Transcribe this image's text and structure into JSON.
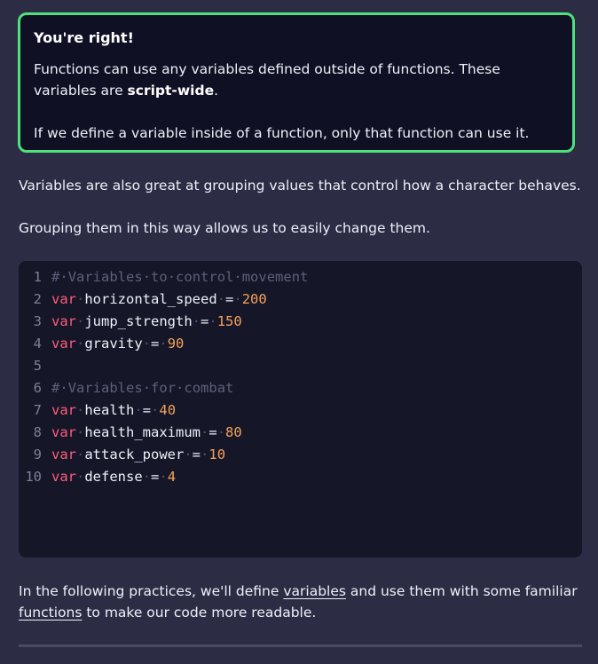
{
  "callout": {
    "title": "You're right!",
    "line1_before": "Functions can use any variables defined outside of functions. These variables are ",
    "line1_bold": "script-wide",
    "line1_after": ".",
    "line2": "If we define a variable inside of a function, only that function can use it."
  },
  "paragraphs": {
    "p1": "Variables are also great at grouping values that control how a character behaves.",
    "p2": "Grouping them in this way allows us to easily change them."
  },
  "code": {
    "lines": [
      {
        "num": "1",
        "comment": "# Variables to control movement"
      },
      {
        "num": "2",
        "kw": "var",
        "name": "horizontal_speed",
        "op": "=",
        "value": "200"
      },
      {
        "num": "3",
        "kw": "var",
        "name": "jump_strength",
        "op": "=",
        "value": "150"
      },
      {
        "num": "4",
        "kw": "var",
        "name": "gravity",
        "op": "=",
        "value": "90"
      },
      {
        "num": "5"
      },
      {
        "num": "6",
        "comment": "# Variables for combat"
      },
      {
        "num": "7",
        "kw": "var",
        "name": "health",
        "op": "=",
        "value": "40"
      },
      {
        "num": "8",
        "kw": "var",
        "name": "health_maximum",
        "op": "=",
        "value": "80"
      },
      {
        "num": "9",
        "kw": "var",
        "name": "attack_power",
        "op": "=",
        "value": "10"
      },
      {
        "num": "10",
        "kw": "var",
        "name": "defense",
        "op": "=",
        "value": "4"
      }
    ]
  },
  "footer": {
    "text_before": "In the following practices, we'll define ",
    "link_variables": "variables",
    "text_middle": " and use them with some familiar ",
    "link_functions": "functions",
    "text_after": " to make our code more readable."
  },
  "colors": {
    "callout_border": "#4ee07a",
    "keyword": "#ff5d7a",
    "number": "#f5a25a",
    "comment": "#5d6079"
  }
}
